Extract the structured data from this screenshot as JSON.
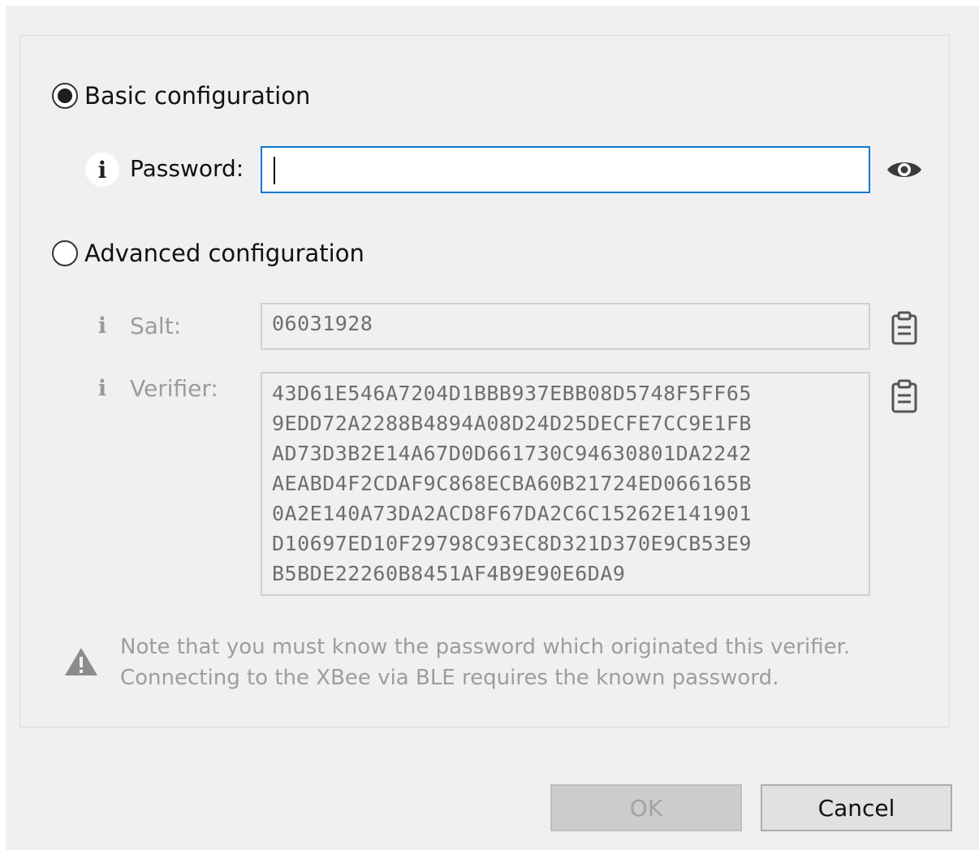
{
  "basic": {
    "label": "Basic configuration",
    "selected": true,
    "password_label": "Password:",
    "password_value": "",
    "info_icon": "info-icon",
    "visibility_icon": "eye-icon"
  },
  "advanced": {
    "label": "Advanced configuration",
    "selected": false,
    "salt_label": "Salt:",
    "salt_value": "06031928",
    "verifier_label": "Verifier:",
    "verifier_lines": [
      "43D61E546A7204D1BBB937EBB08D5748F5FF65",
      "9EDD72A2288B4894A08D24D25DECFE7CC9E1FB",
      "AD73D3B2E14A67D0D661730C94630801DA2242",
      "AEABD4F2CDAF9C868ECBA60B21724ED066165B",
      "0A2E140A73DA2ACD8F67DA2C6C15262E141901",
      "D10697ED10F29798C93EC8D321D370E9CB53E9",
      "B5BDE22260B8451AF4B9E90E6DA9"
    ],
    "copy_icon": "clipboard-icon"
  },
  "warning": {
    "icon": "warning-icon",
    "lines": [
      "Note that you must know the password which originated this verifier.",
      "Connecting to the XBee via BLE requires the known password."
    ]
  },
  "buttons": {
    "ok": "OK",
    "cancel": "Cancel"
  },
  "colors": {
    "focus_border": "#0f78d4",
    "disabled_text": "#9c9c9c",
    "background": "#f0f0f0"
  }
}
